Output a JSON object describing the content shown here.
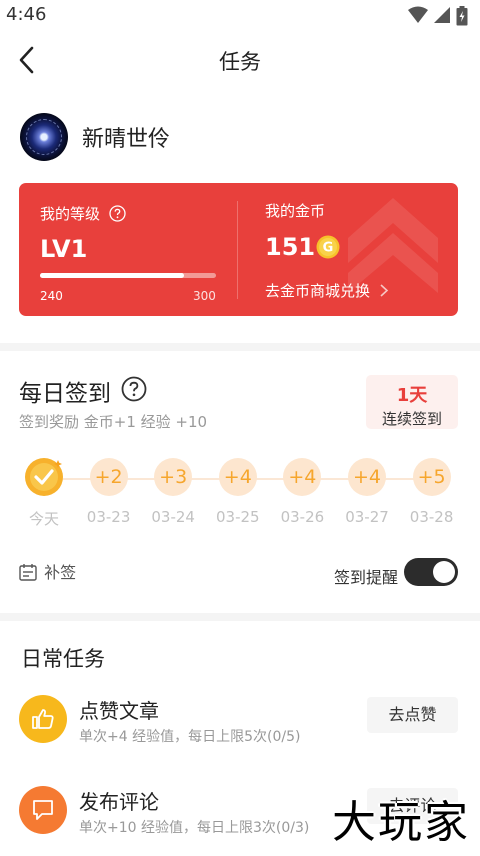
{
  "status_bar": {
    "time": "4:46",
    "icons": [
      "wifi-icon",
      "signal-icon",
      "battery-icon"
    ]
  },
  "header": {
    "title": "任务",
    "back_icon": "chevron-left-icon"
  },
  "profile": {
    "name": "新晴世伶"
  },
  "level_card": {
    "level_label": "我的等级",
    "level_value": "LV1",
    "progress_min": "240",
    "progress_max": "300",
    "progress_fraction": 0.82,
    "coin_label": "我的金币",
    "coin_value": "151",
    "coin_icon_letter": "G",
    "shop_link": "去金币商城兑换",
    "accent_color": "#e8403c"
  },
  "daily_sign": {
    "title": "每日签到",
    "subtitle": "签到奖励 金币+1 经验 +10",
    "streak_days": "1天",
    "streak_label": "连续签到",
    "days": [
      {
        "reward": "",
        "date": "今天",
        "done": true
      },
      {
        "reward": "+2",
        "date": "03-23",
        "done": false
      },
      {
        "reward": "+3",
        "date": "03-24",
        "done": false
      },
      {
        "reward": "+4",
        "date": "03-25",
        "done": false
      },
      {
        "reward": "+4",
        "date": "03-26",
        "done": false
      },
      {
        "reward": "+4",
        "date": "03-27",
        "done": false
      },
      {
        "reward": "+5",
        "date": "03-28",
        "done": false
      }
    ],
    "makeup_label": "补签",
    "reminder_label": "签到提醒",
    "reminder_on": true
  },
  "daily_tasks": {
    "title": "日常任务",
    "items": [
      {
        "name": "点赞文章",
        "desc": "单次+4 经验值，每日上限5次(0/5)",
        "button": "去点赞",
        "icon": "thumbs-up-icon",
        "icon_color": "#f7b81c"
      },
      {
        "name": "发布评论",
        "desc": "单次+10 经验值，每日上限3次(0/3)",
        "button": "去评论",
        "icon": "comment-icon",
        "icon_color": "#f57a32"
      }
    ]
  },
  "watermark": "大玩家"
}
